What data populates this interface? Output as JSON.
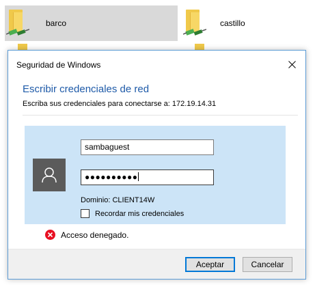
{
  "explorer": {
    "items": [
      {
        "label": "barco",
        "selected": true
      },
      {
        "label": "castillo",
        "selected": false
      }
    ]
  },
  "dialog": {
    "title": "Seguridad de Windows",
    "heading": "Escribir credenciales de red",
    "subheading": "Escriba sus credenciales para conectarse a: 172.19.14.31",
    "username": "sambaguest",
    "password_mask": "●●●●●●●●●●",
    "domain_text": "Dominio: CLIENT14W",
    "remember_label": "Recordar mis credenciales",
    "remember_checked": false,
    "error_text": "Acceso denegado.",
    "ok_label": "Aceptar",
    "cancel_label": "Cancelar"
  },
  "colors": {
    "accent": "#0078d7",
    "heading": "#1e5aa8",
    "panel": "#cce4f7",
    "selection": "#d9d9d9",
    "error": "#e81123"
  },
  "icons": [
    "folder-icon",
    "network-share-icon",
    "close-icon",
    "user-avatar-icon",
    "error-icon"
  ]
}
